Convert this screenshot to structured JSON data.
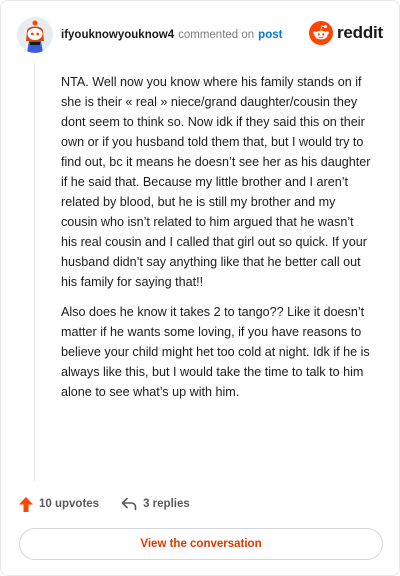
{
  "header": {
    "username": "ifyouknowyouknow4",
    "commented_text": "commented on",
    "post_link": "post",
    "brand": "reddit"
  },
  "comment": {
    "paragraphs": [
      "NTA. Well now you know where his family stands on if she is their « real » niece/grand daughter/cousin they dont seem to think so. Now idk if they said this on their own or if you husband told them that, but I would try to find out, bc it means he doesn’t see her as his daughter if he said that. Because my little brother and I aren’t related by blood, but he is still my brother and my cousin who isn’t related to him argued that he wasn’t his real cousin and I called that girl out so quick. If your husband didn’t say anything like that he better call out his family for saying that!!",
      "Also does he know it takes 2 to tango?? Like it doesn’t matter if he wants some loving, if you have reasons to believe your child might het too cold at night. Idk if he is always like this, but I would take the time to talk to him alone to see what’s up with him."
    ]
  },
  "actions": {
    "upvotes": "10 upvotes",
    "replies": "3 replies"
  },
  "button": {
    "label": "View the conversation"
  },
  "colors": {
    "accent": "#ff4500",
    "link": "#0079d3",
    "button_text": "#d93a00"
  },
  "icons": {
    "avatar": "snoo-avatar",
    "logo": "reddit-logo-icon",
    "upvote": "upvote-arrow-icon",
    "reply": "reply-arrow-icon"
  }
}
